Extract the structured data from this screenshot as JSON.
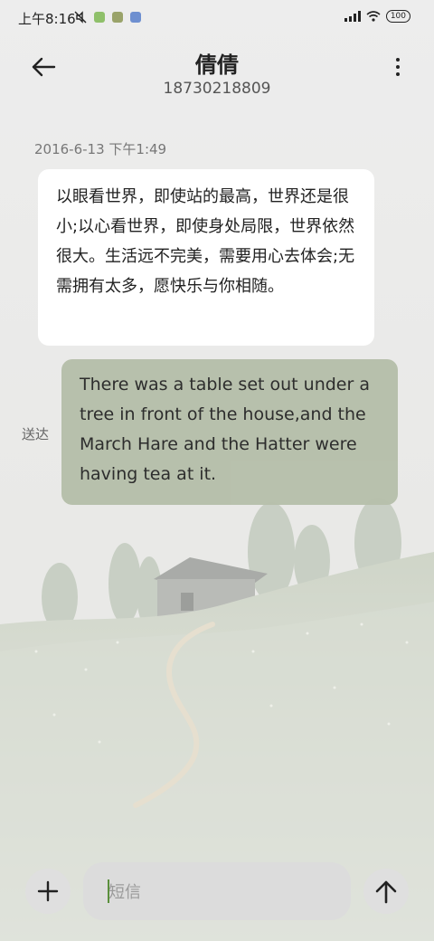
{
  "status_bar": {
    "time": "上午8:16",
    "battery": "100",
    "icons_left": [
      "mute-icon",
      "app-icon-green",
      "app-icon-olive",
      "app-icon-blue"
    ],
    "icons_right": [
      "signal-icon",
      "wifi-icon",
      "battery-icon"
    ]
  },
  "header": {
    "contact_name": "倩倩",
    "contact_number": "18730218809",
    "back_icon": "arrow-left-icon",
    "more_icon": "more-vertical-icon"
  },
  "conversation": {
    "timestamp": "2016-6-13 下午1:49",
    "incoming_message": "以眼看世界，即使站的最高，世界还是很小;以心看世界，即使身处局限，世界依然很大。生活远不完美，需要用心去体会;无需拥有太多，愿快乐与你相随。",
    "outgoing_message": "There was a table set out under a tree in front of the house,and the March Hare and the Hatter were having tea at it.",
    "outgoing_status": "送达"
  },
  "composer": {
    "placeholder": "短信",
    "add_icon": "plus-icon",
    "send_icon": "arrow-up-icon"
  },
  "colors": {
    "background": "#ececec",
    "incoming_bubble": "#ffffff",
    "outgoing_bubble": "#b7c0ab",
    "cursor": "#5a8f3b"
  }
}
